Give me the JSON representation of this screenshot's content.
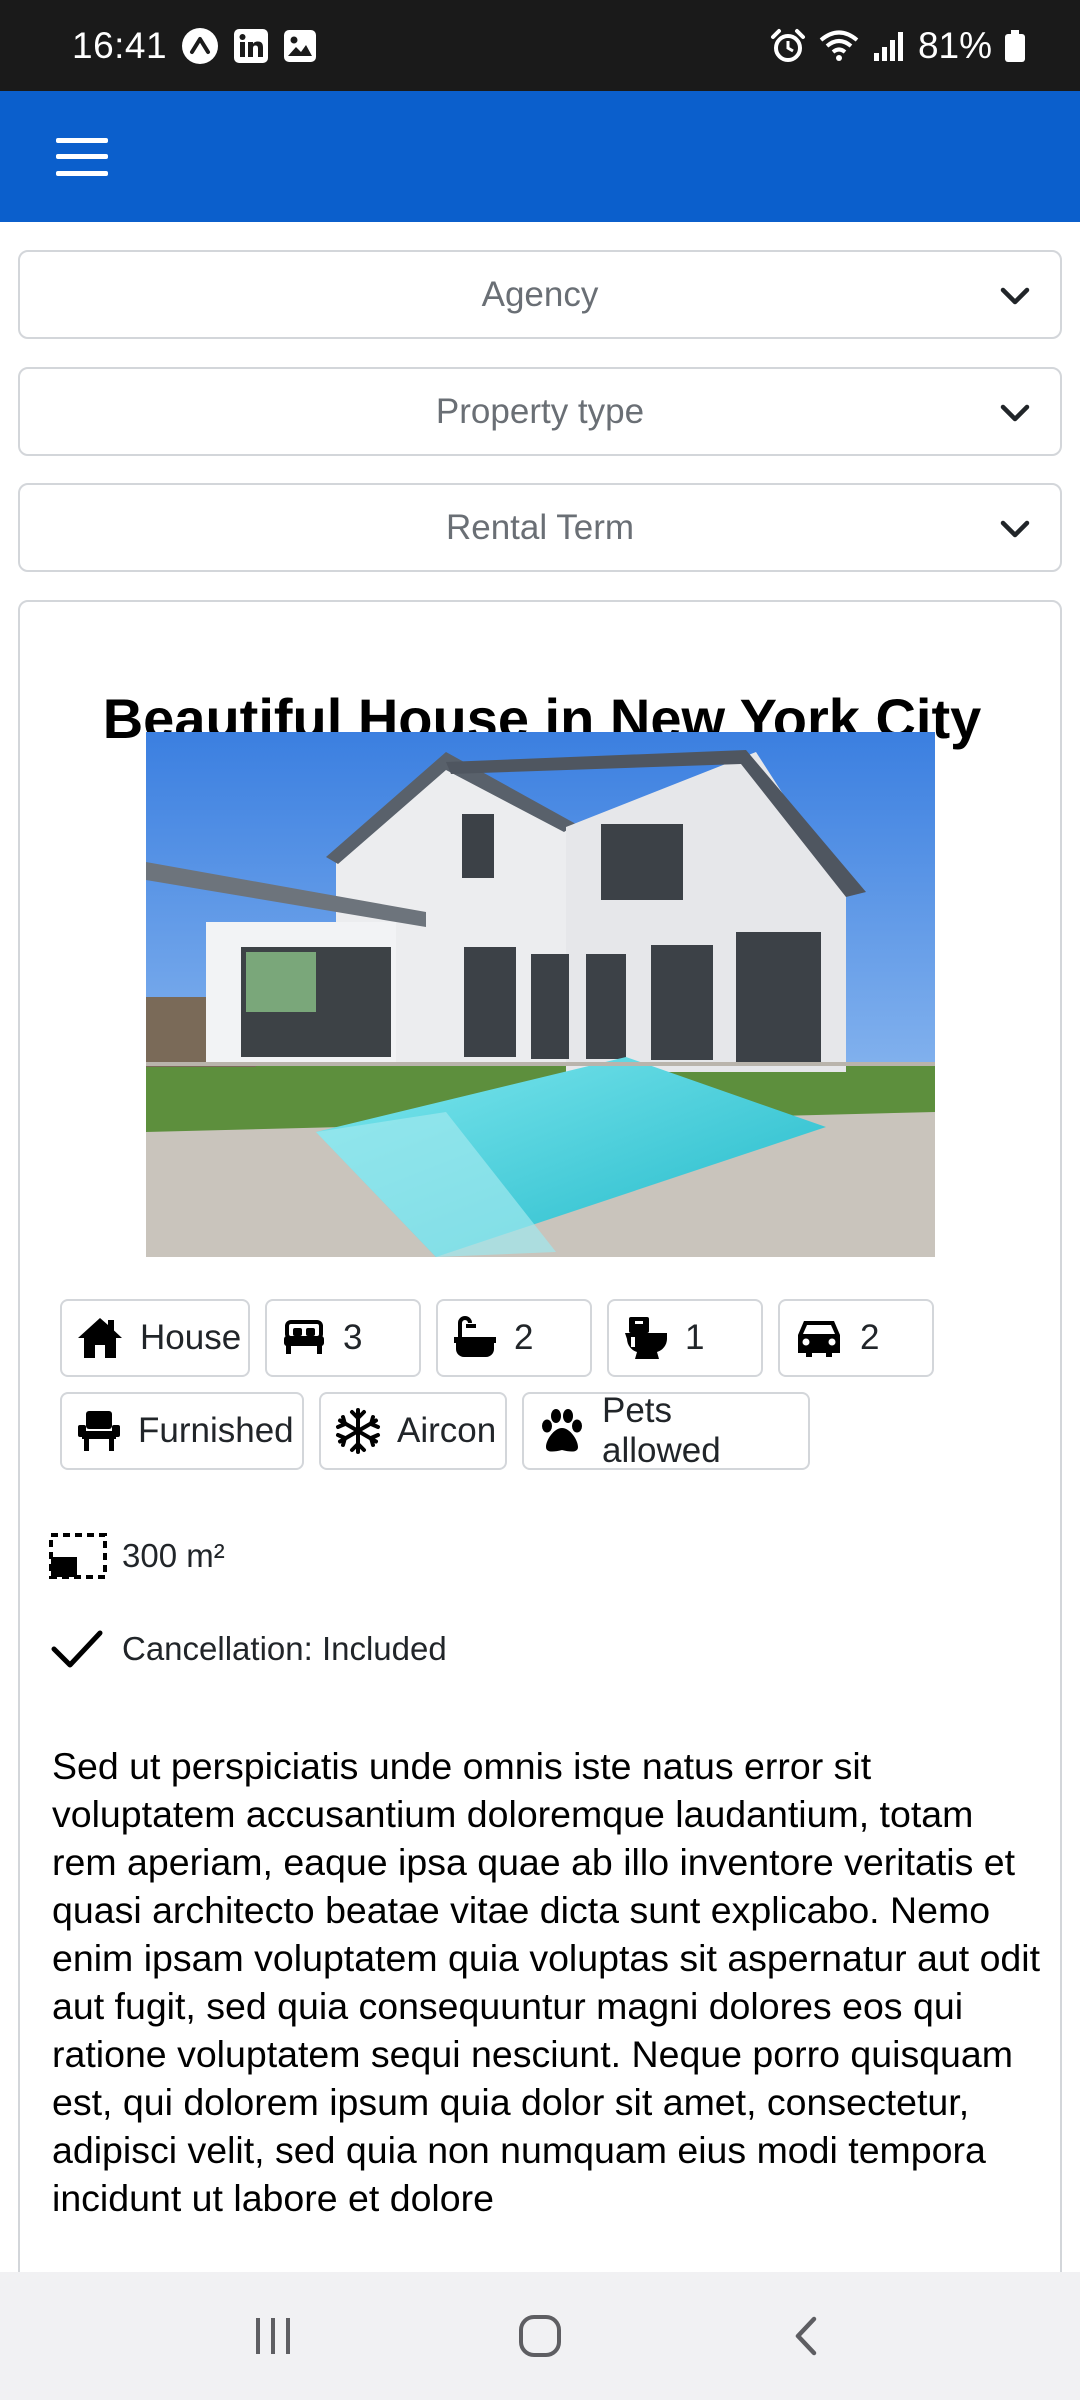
{
  "status_bar": {
    "time": "16:41",
    "battery": "81%",
    "left_icons": [
      "arrow-up-circle-icon",
      "linkedin-icon",
      "gallery-icon"
    ],
    "right_icons": [
      "alarm-icon",
      "wifi-icon",
      "signal-icon",
      "battery-icon"
    ]
  },
  "app_bar": {
    "menu_icon": "hamburger-icon",
    "color": "#0b5fcc"
  },
  "filters": {
    "agency": "Agency",
    "property_type": "Property type",
    "rental_term": "Rental Term"
  },
  "listing": {
    "title": "Beautiful House in New York City",
    "image_alt": "Two-storey white house with a swimming pool",
    "features_row1": [
      {
        "icon": "house-icon",
        "label": "House"
      },
      {
        "icon": "bed-icon",
        "label": "3"
      },
      {
        "icon": "bathtub-icon",
        "label": "2"
      },
      {
        "icon": "toilet-icon",
        "label": "1"
      },
      {
        "icon": "car-icon",
        "label": "2"
      }
    ],
    "features_row2": [
      {
        "icon": "armchair-icon",
        "label": "Furnished"
      },
      {
        "icon": "snowflake-icon",
        "label": "Aircon"
      },
      {
        "icon": "paw-icon",
        "label": "Pets allowed"
      }
    ],
    "area": "300 m²",
    "cancellation": "Cancellation: Included",
    "description": "Sed ut perspiciatis unde omnis iste natus error sit voluptatem accusantium doloremque laudantium, totam rem aperiam, eaque ipsa quae ab illo inventore veritatis et quasi architecto beatae vitae dicta sunt explicabo. Nemo enim ipsam voluptatem quia voluptas sit aspernatur aut odit aut fugit, sed quia consequuntur magni dolores eos qui ratione voluptatem sequi nesciunt. Neque porro quisquam est, qui dolorem ipsum quia dolor sit amet, consectetur, adipisci velit, sed quia non numquam eius modi tempora incidunt ut labore et dolore"
  },
  "nav_bar": {
    "recents": "recents-icon",
    "home": "home-icon",
    "back": "back-icon"
  }
}
